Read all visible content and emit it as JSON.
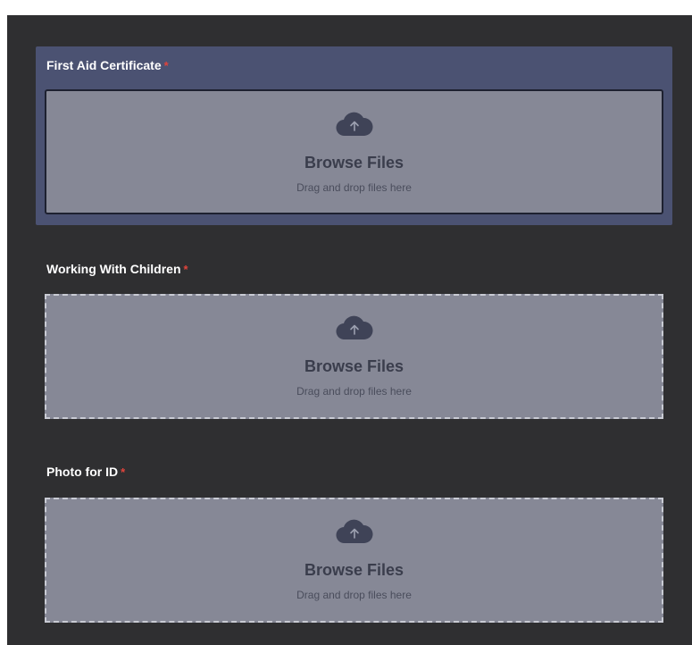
{
  "fields": [
    {
      "label": "First Aid Certificate",
      "required_mark": "*",
      "browse_label": "Browse Files",
      "drag_text": "Drag and drop files here",
      "upload_icon": "cloud-upload-icon"
    },
    {
      "label": "Working With Children",
      "required_mark": "*",
      "browse_label": "Browse Files",
      "drag_text": "Drag and drop files here",
      "upload_icon": "cloud-upload-icon"
    },
    {
      "label": "Photo for ID",
      "required_mark": "*",
      "browse_label": "Browse Files",
      "drag_text": "Drag and drop files here",
      "upload_icon": "cloud-upload-icon"
    }
  ],
  "colors": {
    "background": "#2f2f31",
    "active_field": "#4b5272",
    "dropzone": "#868896",
    "required": "#e0443c",
    "icon": "#3f4357"
  }
}
